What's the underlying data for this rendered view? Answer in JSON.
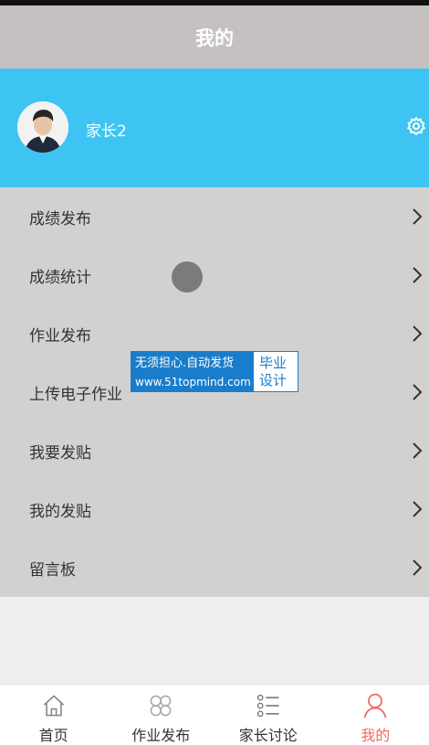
{
  "header": {
    "title": "我的"
  },
  "profile": {
    "username": "家长2",
    "avatar_icon": "user-avatar",
    "settings_icon": "gear-icon"
  },
  "menu": {
    "items": [
      {
        "label": "成绩发布"
      },
      {
        "label": "成绩统计"
      },
      {
        "label": "作业发布"
      },
      {
        "label": "上传电子作业"
      },
      {
        "label": "我要发贴"
      },
      {
        "label": "我的发贴"
      },
      {
        "label": "留言板"
      }
    ]
  },
  "watermark": {
    "line1": "无须担心.自动发货",
    "line2": "www.51topmind.com",
    "badge_line1": "毕业",
    "badge_line2": "设计"
  },
  "tabbar": {
    "tabs": [
      {
        "label": "首页",
        "icon": "home-icon"
      },
      {
        "label": "作业发布",
        "icon": "grid-icon"
      },
      {
        "label": "家长讨论",
        "icon": "list-icon"
      },
      {
        "label": "我的",
        "icon": "person-icon"
      }
    ],
    "active_index": 3
  },
  "colors": {
    "header_bg": "#c6c1c1",
    "profile_bg": "#3ec4f2",
    "menu_bg": "#d3d1d0",
    "active_tab": "#f06a63"
  }
}
